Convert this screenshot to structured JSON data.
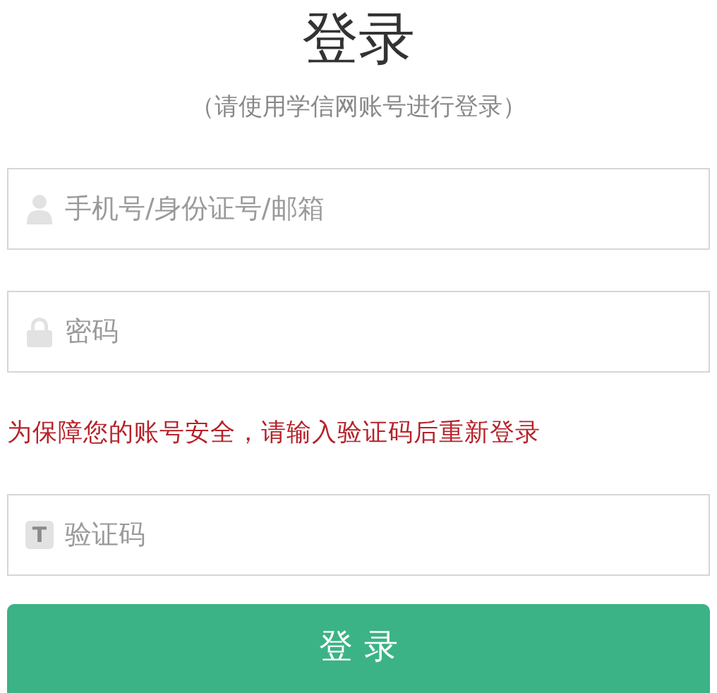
{
  "title": "登录",
  "subtitle": "（请使用学信网账号进行登录）",
  "fields": [
    {
      "kind": "account",
      "placeholder": "手机号/身份证号/邮箱"
    },
    {
      "kind": "password",
      "placeholder": "密码"
    }
  ],
  "warning": "为保障您的账号安全，请输入验证码后重新登录",
  "captcha": {
    "kind": "captcha",
    "icon_text": "T",
    "placeholder": "验证码"
  },
  "submit_button": "登 录"
}
